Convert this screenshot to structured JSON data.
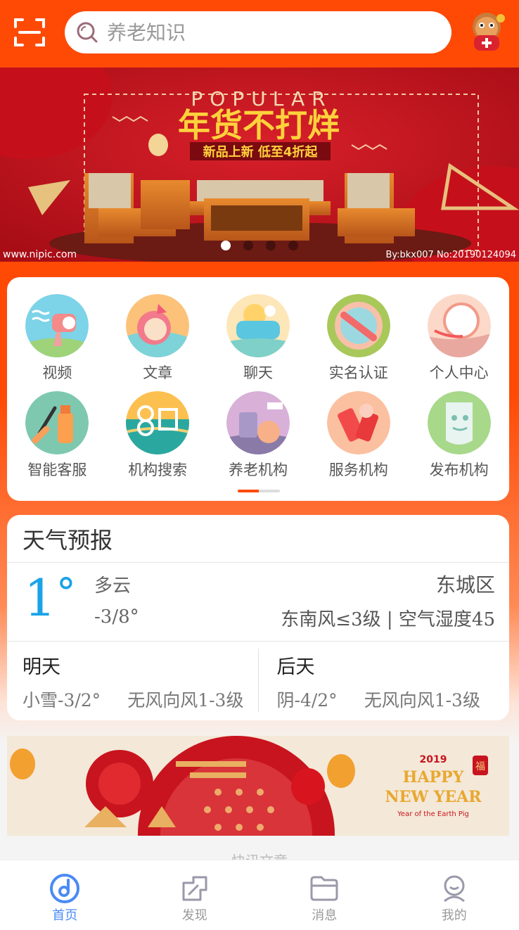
{
  "colors": {
    "brand": "#ff4a05",
    "weather_temp": "#1aa3e8",
    "tab_active": "#4a8af4",
    "tab_inactive": "#999999"
  },
  "header": {
    "scan_icon": "scan-icon",
    "search_placeholder": "养老知识",
    "avatar_icon": "mascot-avatar-icon"
  },
  "banner": {
    "title_en": "POPULAR",
    "headline": "年货不打烊",
    "subline": "新品上新  低至4折起",
    "watermark_left": "www.nipic.com",
    "watermark_right": "By:bkx007 No:20190124094",
    "slide_count": 4,
    "active_slide": 1
  },
  "functions": [
    {
      "label": "视频",
      "icon": "video-icon"
    },
    {
      "label": "文章",
      "icon": "article-icon"
    },
    {
      "label": "聊天",
      "icon": "chat-icon"
    },
    {
      "label": "实名认证",
      "icon": "verify-icon"
    },
    {
      "label": "个人中心",
      "icon": "profile-icon"
    },
    {
      "label": "智能客服",
      "icon": "smart-service-icon"
    },
    {
      "label": "机构搜索",
      "icon": "org-search-icon"
    },
    {
      "label": "养老机构",
      "icon": "elder-org-icon"
    },
    {
      "label": "服务机构",
      "icon": "service-org-icon"
    },
    {
      "label": "发布机构",
      "icon": "publish-org-icon"
    }
  ],
  "function_pager": {
    "pages": 2,
    "current": 1
  },
  "weather": {
    "title": "天气预报",
    "today": {
      "temp": "1",
      "degree": "°",
      "condition": "多云",
      "range": "-3/8°",
      "district": "东城区",
      "wind_humidity": "东南风≤3级 | 空气湿度45"
    },
    "tomorrow": {
      "day": "明天",
      "weather": "小雪-3/2°",
      "wind": "无风向风1-3级"
    },
    "after_tomorrow": {
      "day": "后天",
      "weather": "阴-4/2°",
      "wind": "无风向风1-3级"
    }
  },
  "promo_banner": {
    "year": "2019",
    "line1": "HAPPY",
    "line2": "NEW YEAR",
    "line3": "Year of the Earth Pig",
    "fu": "福"
  },
  "peek_text": "快讯文章",
  "tabbar": [
    {
      "label": "首页",
      "icon": "home-icon",
      "active": true
    },
    {
      "label": "发现",
      "icon": "discover-icon",
      "active": false
    },
    {
      "label": "消息",
      "icon": "message-folder-icon",
      "active": false
    },
    {
      "label": "我的",
      "icon": "user-icon",
      "active": false
    }
  ]
}
